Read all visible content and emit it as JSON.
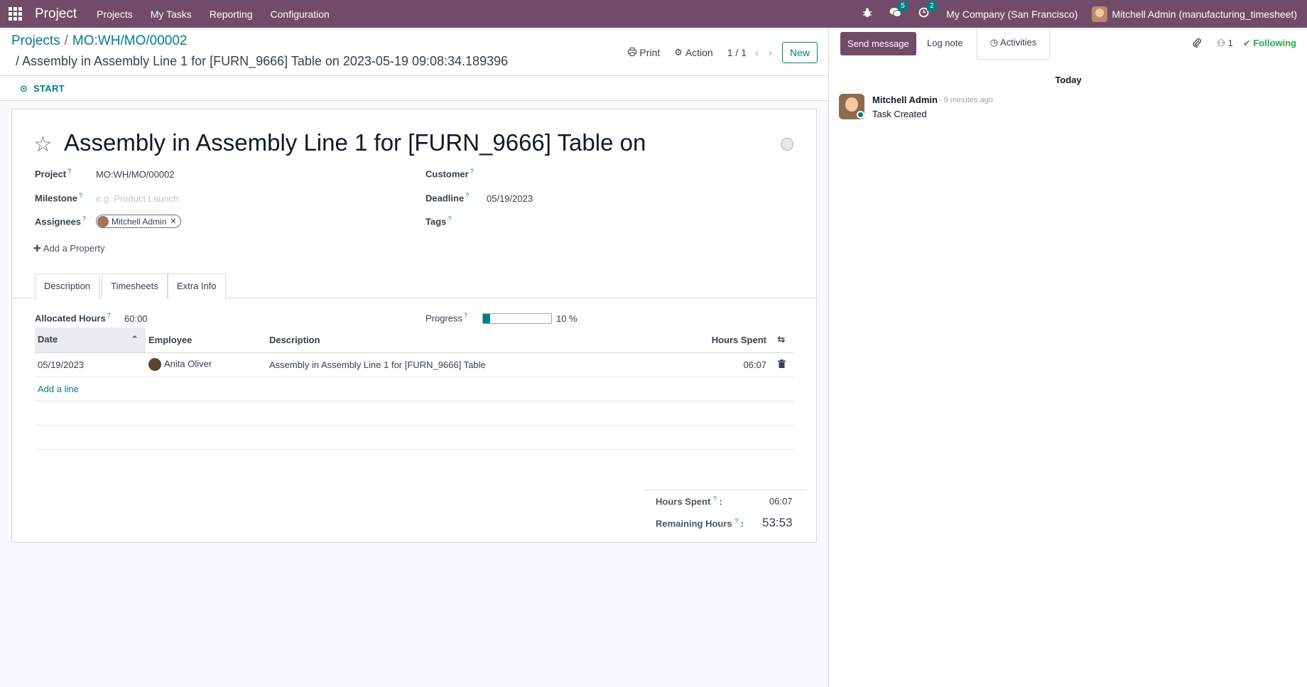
{
  "navbar": {
    "app_name": "Project",
    "menus": [
      "Projects",
      "My Tasks",
      "Reporting",
      "Configuration"
    ],
    "messages_count": "5",
    "activities_count": "2",
    "company": "My Company (San Francisco)",
    "user": "Mitchell Admin (manufacturing_timesheet)"
  },
  "control_panel": {
    "breadcrumb": [
      "Projects",
      "MO:WH/MO/00002"
    ],
    "breadcrumb_sep": "/",
    "record_title": "/ Assembly in Assembly Line 1 for [FURN_9666] Table on 2023-05-19 09:08:34.189396",
    "print_label": "Print",
    "action_label": "Action",
    "pager": "1 / 1",
    "new_label": "New"
  },
  "statusbar": {
    "start_label": "START"
  },
  "task": {
    "name": "Assembly in Assembly Line 1 for [FURN_9666] Table on",
    "fields": {
      "project_label": "Project",
      "project_value": "MO:WH/MO/00002",
      "milestone_label": "Milestone",
      "milestone_placeholder": "e.g. Product Launch",
      "assignees_label": "Assignees",
      "assignee": "Mitchell Admin",
      "customer_label": "Customer",
      "deadline_label": "Deadline",
      "deadline_value": "05/19/2023",
      "tags_label": "Tags"
    },
    "add_property": "Add a Property",
    "tabs": [
      "Description",
      "Timesheets",
      "Extra Info"
    ],
    "active_tab": "Timesheets",
    "allocated_hours_label": "Allocated Hours",
    "allocated_hours": "60:00",
    "progress_label": "Progress",
    "progress_percent": 10,
    "progress_text": "10 %"
  },
  "timesheets": {
    "columns": [
      "Date",
      "Employee",
      "Description",
      "Hours Spent"
    ],
    "rows": [
      {
        "date": "05/19/2023",
        "employee": "Anita Oliver",
        "description": "Assembly in Assembly Line 1 for [FURN_9666] Table",
        "hours": "06:07"
      }
    ],
    "add_line": "Add a line",
    "totals": {
      "hours_spent_label": "Hours Spent",
      "hours_spent": "06:07",
      "remaining_label": "Remaining Hours",
      "remaining": "53:53"
    }
  },
  "chatter": {
    "send_message": "Send message",
    "log_note": "Log note",
    "activities": "Activities",
    "followers_count": "1",
    "following": "Following",
    "date_separator": "Today",
    "messages": [
      {
        "author": "Mitchell Admin",
        "time": "- 9 minutes ago",
        "body": "Task Created"
      }
    ]
  },
  "colors": {
    "brand": "#714B67",
    "accent": "#017E84",
    "following": "#28a745"
  }
}
